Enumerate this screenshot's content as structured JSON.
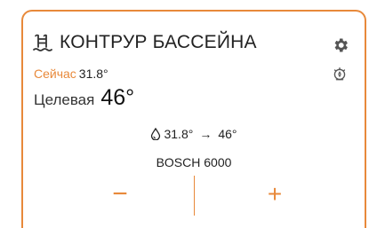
{
  "card": {
    "title": "КОНТРУР БАССЕЙНА",
    "accent_color": "#e8893a",
    "title_icon": "pool-ladder-icon",
    "settings_icon": "gear-icon",
    "status_icon": "burner-icon"
  },
  "current": {
    "label": "Сейчас",
    "value": "31.8°"
  },
  "target": {
    "label": "Целевая",
    "value": "46°"
  },
  "flow": {
    "icon": "water-drop-icon",
    "from": "31.8°",
    "arrow": "→",
    "to": "46°"
  },
  "device": {
    "name": "BOSCH 6000"
  },
  "controls": {
    "decrease_label": "−",
    "increase_label": "+"
  }
}
